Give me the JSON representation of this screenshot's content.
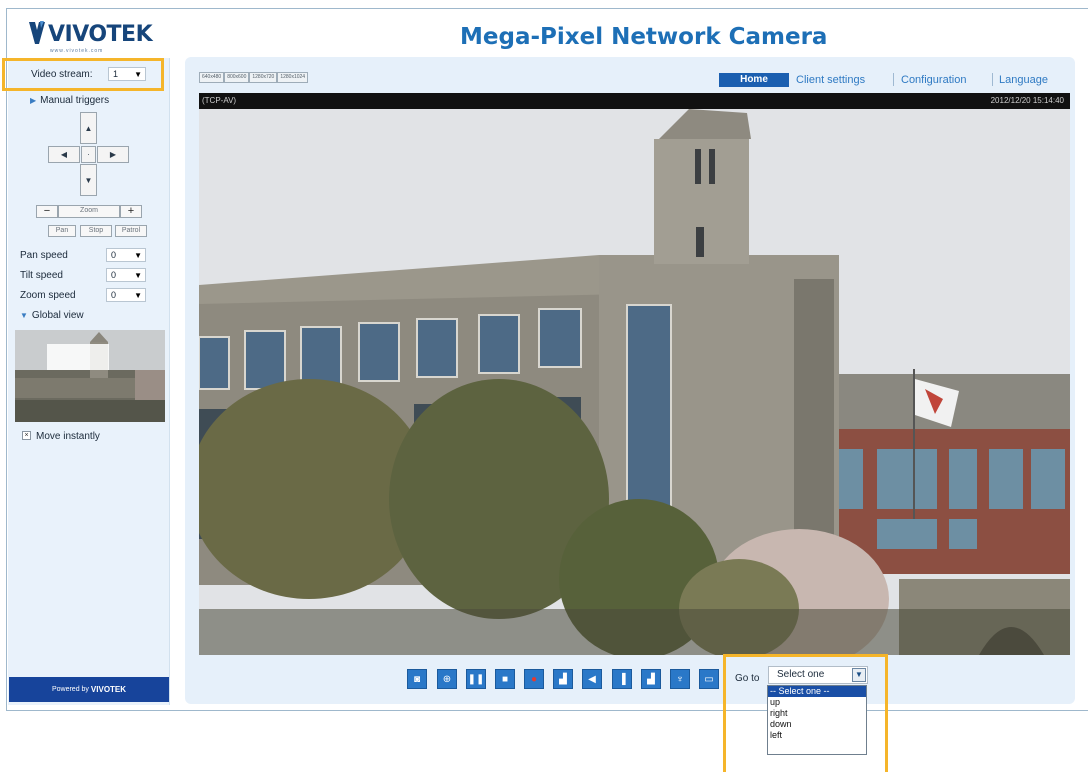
{
  "app": {
    "brand": "VIVOTEK",
    "brand_sub": "www.vivotek.com",
    "title": "Mega-Pixel Network Camera"
  },
  "left": {
    "video_stream_label": "Video stream:",
    "video_stream_value": "1",
    "manual_triggers": "Manual triggers",
    "zoom_label": "Zoom",
    "pan_button": "Pan",
    "stop_button": "Stop",
    "patrol_button": "Patrol",
    "pan_speed_label": "Pan speed",
    "pan_speed_value": "0",
    "tilt_speed_label": "Tilt speed",
    "tilt_speed_value": "0",
    "zoom_speed_label": "Zoom speed",
    "zoom_speed_value": "0",
    "global_view": "Global view",
    "move_instantly": "Move instantly",
    "powered_by": "Powered by",
    "powered_brand": "VIVOTEK"
  },
  "nav": {
    "home": "Home",
    "client_settings": "Client settings",
    "configuration": "Configuration",
    "language": "Language"
  },
  "video": {
    "resolution_tabs": [
      "640x480",
      "800x600",
      "1280x720",
      "1280x1024"
    ],
    "protocol": "(TCP-AV)",
    "timestamp": "2012/12/20 15:14:40"
  },
  "controls": {
    "buttons": [
      "snapshot",
      "digital-zoom",
      "pause",
      "stop",
      "record",
      "volume",
      "mute",
      "talk",
      "mic-volume",
      "microphone",
      "fullscreen"
    ],
    "goto_label": "Go to",
    "goto_selected": "Select one",
    "goto_options": [
      "-- Select one --",
      "up",
      "right",
      "down",
      "left"
    ]
  },
  "colors": {
    "brand_blue": "#1b5fb0",
    "highlight": "#f5b52a",
    "panel_bg": "#e6f0fa"
  }
}
